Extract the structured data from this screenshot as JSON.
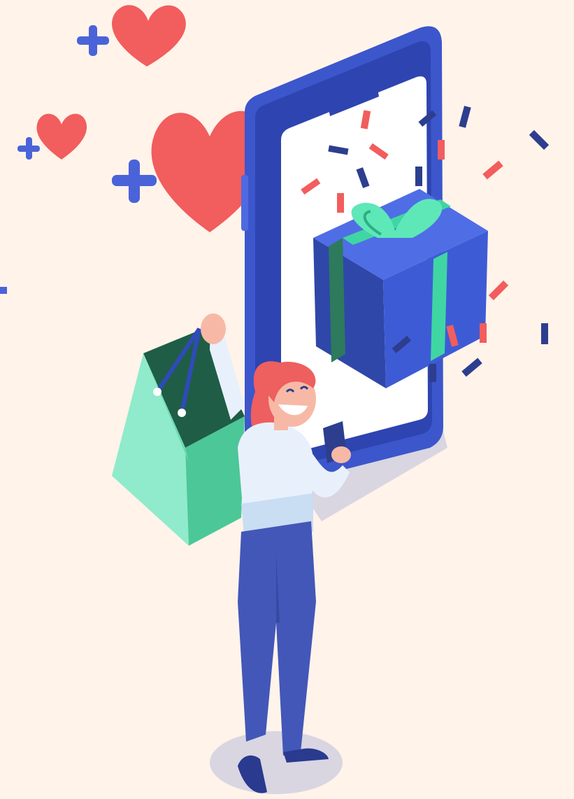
{
  "scene": {
    "description_label": "",
    "colors": {
      "background": "#fff3ea",
      "heart": "#f25d5d",
      "plus": "#4a63d8",
      "phone_frame": "#3c56cc",
      "phone_screen": "#ffffff",
      "gift_box": "#3e5bd6",
      "gift_ribbon": "#3fd6a3",
      "shopping_bag": "#7fe3c2",
      "bag_handle": "#2f4bb8",
      "hair": "#ee5f5f",
      "skin": "#f7b9a6",
      "top": "#e8f1fb",
      "pants": "#4357b8",
      "shoes": "#2a3a8f",
      "shadow": "#d9d6e2",
      "confetti_red": "#f25d5d",
      "confetti_navy": "#2d3e8f"
    },
    "icons": [
      "heart-icon",
      "plus-icon",
      "smartphone-icon",
      "gift-box-icon",
      "shopping-bag-icon",
      "confetti-icon",
      "woman-illustration"
    ]
  }
}
